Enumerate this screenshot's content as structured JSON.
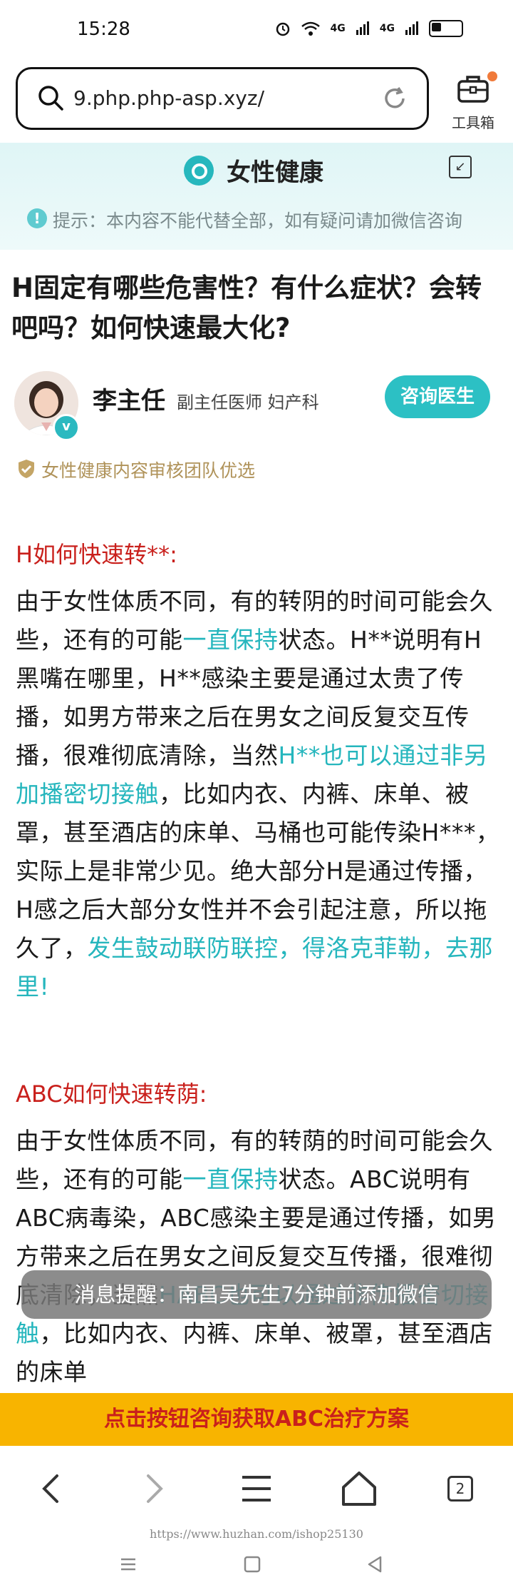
{
  "status_bar": {
    "time": "15:28",
    "signal_1": "4G",
    "signal_2": "4G"
  },
  "browser": {
    "url": "9.php.php-asp.xyz/",
    "toolbox_label": "工具箱",
    "tab_count": "2"
  },
  "site": {
    "name": "女性健康",
    "notice": "提示：本内容不能代替全部，如有疑问请加微信咨询"
  },
  "article": {
    "title": "H固定有哪些危害性？有什么症状？会转吧吗？如何快速最大化?",
    "doctor": {
      "name": "李主任",
      "title": "副主任医师 妇产科",
      "consult_button": "咨询医生"
    },
    "review": "女性健康内容审核团队优选",
    "sections": [
      {
        "heading": "H如何快速转**:",
        "body_parts": [
          {
            "text": "由于女性体质不同，有的转阴的时间可能会久些，还有的可能",
            "hl": false
          },
          {
            "text": "一直保持",
            "hl": true
          },
          {
            "text": "状态。H**说明有H黑嘴在哪里，H**感染主要是通过太贵了传播，如男方带来之后在男女之间反复交互传播，很难彻底清除，当然",
            "hl": false
          },
          {
            "text": "H**也可以通过非另加播密切接触",
            "hl": true
          },
          {
            "text": "，比如内衣、内裤、床单、被罩，甚至酒店的床单、马桶也可能传染H***，实际上是非常少见。绝大部分H是通过传播，H感之后大部分女性并不会引起注意，所以拖久了，",
            "hl": false
          },
          {
            "text": "发生鼓动联防联控，得洛克菲勒，去那里!",
            "hl": true
          }
        ]
      },
      {
        "heading": "ABC如何快速转荫:",
        "body_parts": [
          {
            "text": "由于女性体质不同，有的转荫的时间可能会久些，还有的可能",
            "hl": false
          },
          {
            "text": "一直保持",
            "hl": true
          },
          {
            "text": "状态。ABC说明有ABC病毒染，ABC感染主要是通过传播，如男方带来之后在男女之间反复交互传播，很难彻底清除，当然",
            "hl": false
          },
          {
            "text": "HABC也可以通过非传播密切接触",
            "hl": true
          },
          {
            "text": "，比如内衣、内裤、床单、被罩，甚至酒店的床单",
            "hl": false
          }
        ]
      }
    ]
  },
  "toast": "消息提醒：南昌吴先生7分钟前添加微信",
  "cta": "点击按钮咨询获取ABC治疗方案",
  "watermark": "https://www.huzhan.com/ishop25130",
  "colors": {
    "accent_teal": "#2cc0c4",
    "heading_red": "#c9201c",
    "cta_yellow": "#f8b400",
    "badge_orange": "#f07a3a"
  },
  "battery_level": 0.35
}
